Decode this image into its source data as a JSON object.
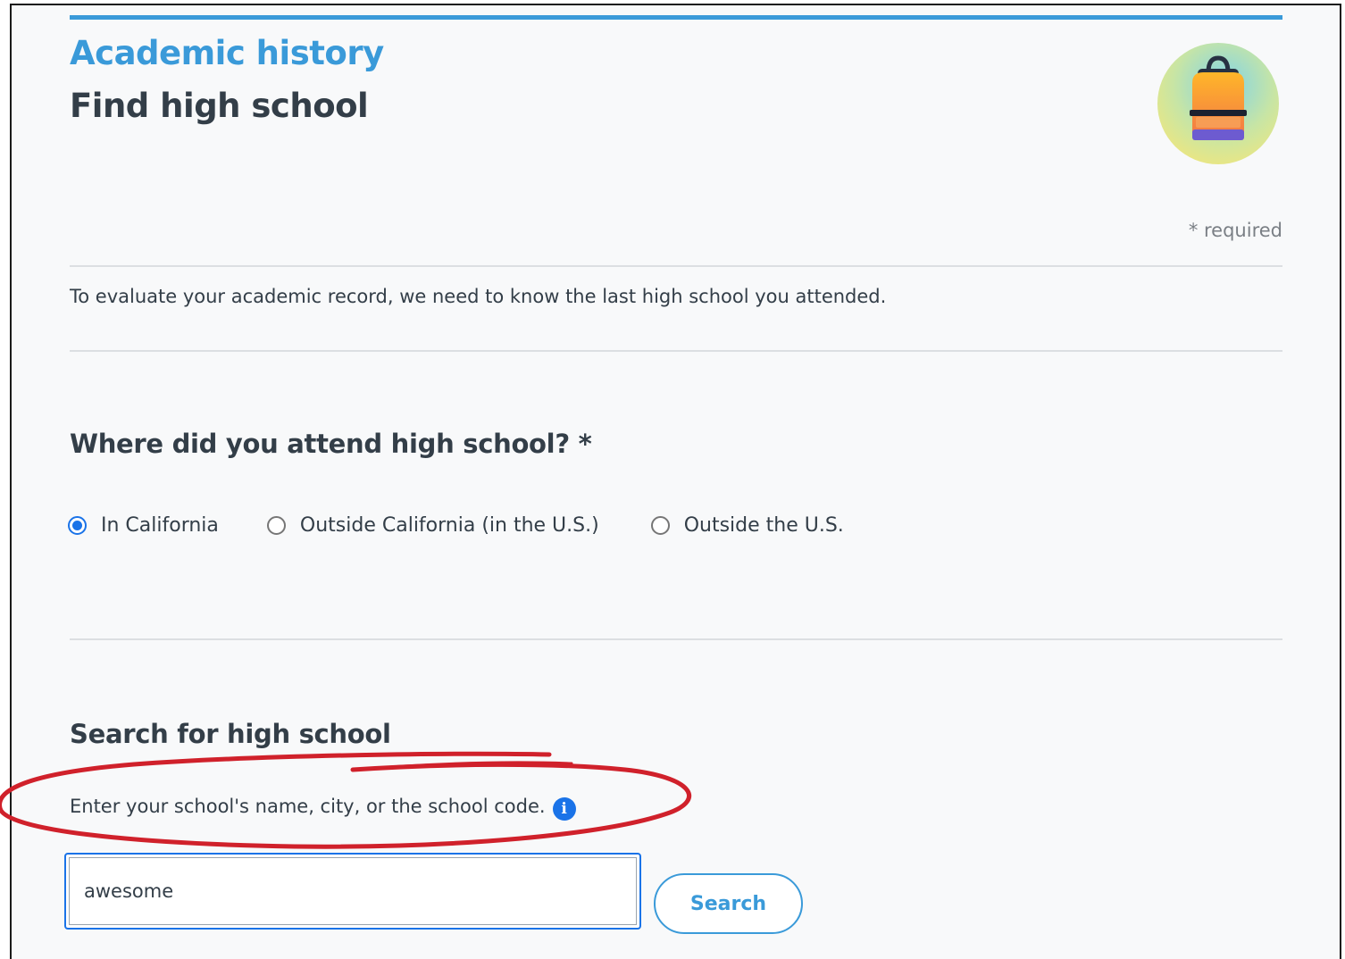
{
  "header": {
    "section_title": "Academic history",
    "page_title": "Find high school",
    "required_note": "* required",
    "illustration_icon": "backpack-icon"
  },
  "intro": {
    "text": "To evaluate your academic record, we need to know the last high school you attended."
  },
  "location_question": {
    "title": "Where did you attend high school? *",
    "options": [
      {
        "label": "In California",
        "selected": true
      },
      {
        "label": "Outside California (in the U.S.)",
        "selected": false
      },
      {
        "label": "Outside the U.S.",
        "selected": false
      }
    ]
  },
  "search": {
    "title": "Search for high school",
    "hint": "Enter your school's name, city, or the school code.",
    "info_icon": "info-icon",
    "input_value": "awesome",
    "button_label": "Search"
  },
  "colors": {
    "accent": "#3a9ad9",
    "radio_selected": "#1a73e8",
    "annotation": "#d0212b",
    "text": "#333e48",
    "background": "#f8f9fa"
  }
}
